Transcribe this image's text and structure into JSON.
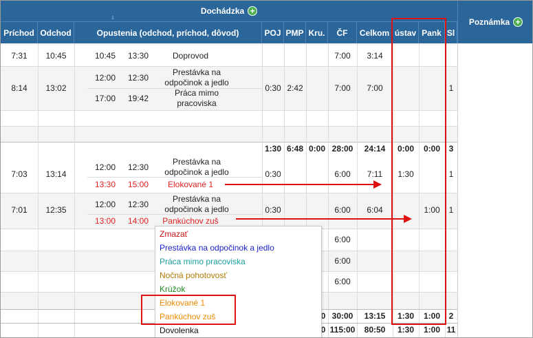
{
  "header": {
    "section_title": "Dochádzka",
    "note_title": "Poznámka",
    "columns": [
      "Príchod",
      "Odchod",
      "Opustenia (odchod, príchod, dôvod)",
      "POJ",
      "PMP",
      "Kru.",
      "ČF",
      "Celkom",
      "ústav",
      "Pank",
      "Sl"
    ],
    "partial_top": "1"
  },
  "rows": [
    {
      "arrival": "7:31",
      "departure": "10:45",
      "leaves": [
        {
          "out": "10:45",
          "in": "13:30",
          "reason": "Doprovod"
        }
      ],
      "poj": "",
      "pmp": "",
      "kru": "",
      "cf": "7:00",
      "total": "3:14",
      "ustav": "",
      "pank": "",
      "sl": ""
    },
    {
      "arrival": "8:14",
      "departure": "13:02",
      "leaves": [
        {
          "out": "12:00",
          "in": "12:30",
          "reason": "Prestávka na odpočinok a jedlo"
        },
        {
          "out": "17:00",
          "in": "19:42",
          "reason": "Práca mimo pracoviska"
        }
      ],
      "poj": "0:30",
      "pmp": "2:42",
      "kru": "",
      "cf": "7:00",
      "total": "7:00",
      "ustav": "",
      "pank": "",
      "sl": "1"
    },
    {
      "arrival": "7:03",
      "departure": "13:14",
      "leaves": [
        {
          "out": "12:00",
          "in": "12:30",
          "reason": "Prestávka na odpočinok a jedlo"
        },
        {
          "out": "13:30",
          "in": "15:00",
          "reason": "Elokované 1"
        }
      ],
      "poj": "0:30",
      "pmp": "",
      "kru": "",
      "cf": "6:00",
      "total": "7:11",
      "ustav": "1:30",
      "pank": "",
      "sl": "1"
    },
    {
      "arrival": "7:01",
      "departure": "12:35",
      "leaves": [
        {
          "out": "12:00",
          "in": "12:30",
          "reason": "Prestávka na odpočinok a jedlo"
        },
        {
          "out": "13:00",
          "in": "14:00",
          "reason": "Pankúchov zuš"
        }
      ],
      "poj": "0:30",
      "pmp": "",
      "kru": "",
      "cf": "6:00",
      "total": "6:04",
      "ustav": "",
      "pank": "1:00",
      "sl": "1"
    }
  ],
  "summary1": {
    "poj": "1:30",
    "pmp": "6:48",
    "kru": "0:00",
    "cf": "28:00",
    "total": "24:14",
    "ustav": "0:00",
    "pank": "0:00",
    "sl": "3"
  },
  "extra_rows": [
    {
      "cf": "6:00"
    },
    {
      "cf": "6:00"
    },
    {
      "cf": "6:00"
    }
  ],
  "summary2": {
    "kru": "0",
    "cf": "30:00",
    "total": "13:15",
    "ustav": "1:30",
    "pank": "1:00",
    "sl": "2"
  },
  "summary3": {
    "kru": "0",
    "cf": "115:00",
    "total": "80:50",
    "ustav": "1:30",
    "pank": "1:00",
    "sl": "11"
  },
  "dropdown": {
    "items": [
      {
        "label": "Zmazať",
        "color": "#cc1111"
      },
      {
        "label": "Prestávka na odpočinok a jedlo",
        "color": "#1a22cc"
      },
      {
        "label": "Práca mimo pracoviska",
        "color": "#1aa0a0"
      },
      {
        "label": "Nočná pohotovosť",
        "color": "#b07a00"
      },
      {
        "label": "Krúžok",
        "color": "#228822"
      },
      {
        "label": "Elokované 1",
        "color": "#f08a00"
      },
      {
        "label": "Pankúchov zuš",
        "color": "#f08a00"
      },
      {
        "label": "Dovolenka",
        "color": "#111111"
      }
    ]
  },
  "colors": {
    "header_bg": "#2b669b",
    "highlight": "#e01010"
  }
}
